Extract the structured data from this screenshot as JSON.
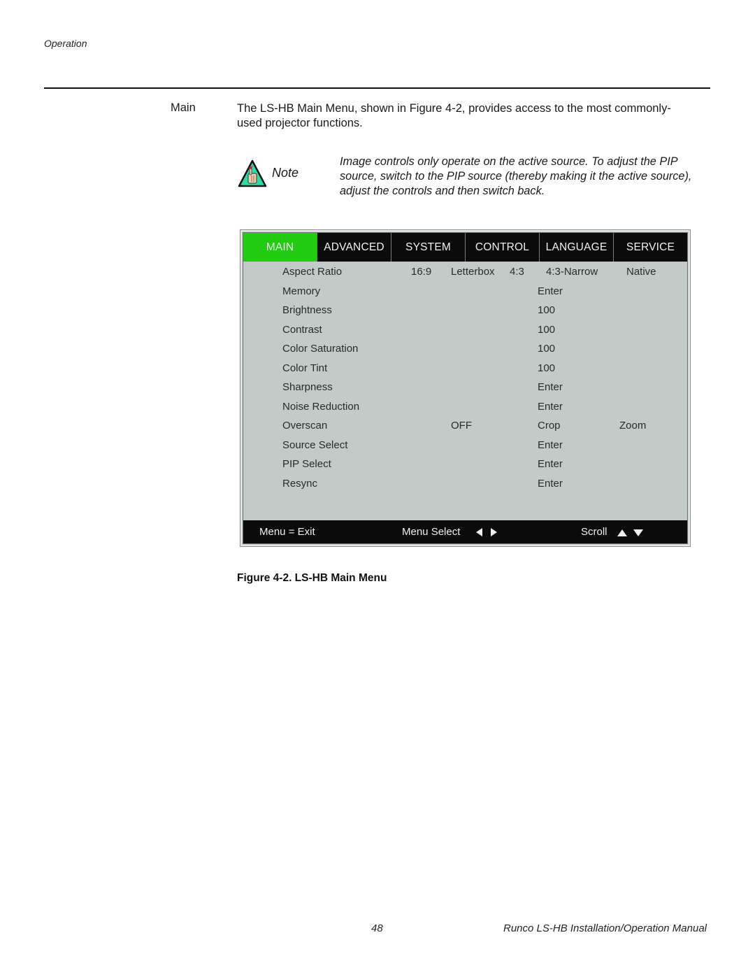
{
  "header": {
    "running_head": "Operation"
  },
  "section": {
    "label": "Main",
    "body": "The LS-HB Main Menu, shown in Figure 4-2, provides access to the most commonly-used projector functions."
  },
  "note": {
    "icon": "note-hand-warning-icon",
    "label": "Note",
    "text": "Image controls only operate on the active source. To adjust the PIP source, switch to the PIP source (thereby making it the active source), adjust the controls and then switch back."
  },
  "osd_menu": {
    "colors": {
      "active_tab": "#22cc11",
      "tab_bar": "#0b0b0b",
      "panel": "#c3cbc8"
    },
    "tabs": [
      {
        "label": "MAIN",
        "active": true
      },
      {
        "label": "ADVANCED",
        "active": false
      },
      {
        "label": "SYSTEM",
        "active": false
      },
      {
        "label": "CONTROL",
        "active": false
      },
      {
        "label": "LANGUAGE",
        "active": false
      },
      {
        "label": "SERVICE",
        "active": false
      }
    ],
    "rows": [
      {
        "label": "Aspect Ratio",
        "options": [
          "16:9",
          "Letterbox",
          "4:3",
          "4:3-Narrow",
          "Native"
        ]
      },
      {
        "label": "Memory",
        "options": [
          "Enter"
        ]
      },
      {
        "label": "Brightness",
        "options": [
          "100"
        ]
      },
      {
        "label": "Contrast",
        "options": [
          "100"
        ]
      },
      {
        "label": "Color Saturation",
        "options": [
          "100"
        ]
      },
      {
        "label": "Color Tint",
        "options": [
          "100"
        ]
      },
      {
        "label": "Sharpness",
        "options": [
          "Enter"
        ]
      },
      {
        "label": "Noise Reduction",
        "options": [
          "Enter"
        ]
      },
      {
        "label": "Overscan",
        "options": [
          "OFF",
          "Crop",
          "Zoom"
        ]
      },
      {
        "label": "Source Select",
        "options": [
          "Enter"
        ]
      },
      {
        "label": "PIP Select",
        "options": [
          "Enter"
        ]
      },
      {
        "label": "Resync",
        "options": [
          "Enter"
        ]
      }
    ],
    "footer": {
      "exit_hint": "Menu = Exit",
      "select_hint": "Menu Select",
      "scroll_hint": "Scroll"
    }
  },
  "figure": {
    "caption": "Figure 4-2. LS-HB Main Menu"
  },
  "page_footer": {
    "page_number": "48",
    "manual_title": "Runco LS-HB Installation/Operation Manual"
  }
}
